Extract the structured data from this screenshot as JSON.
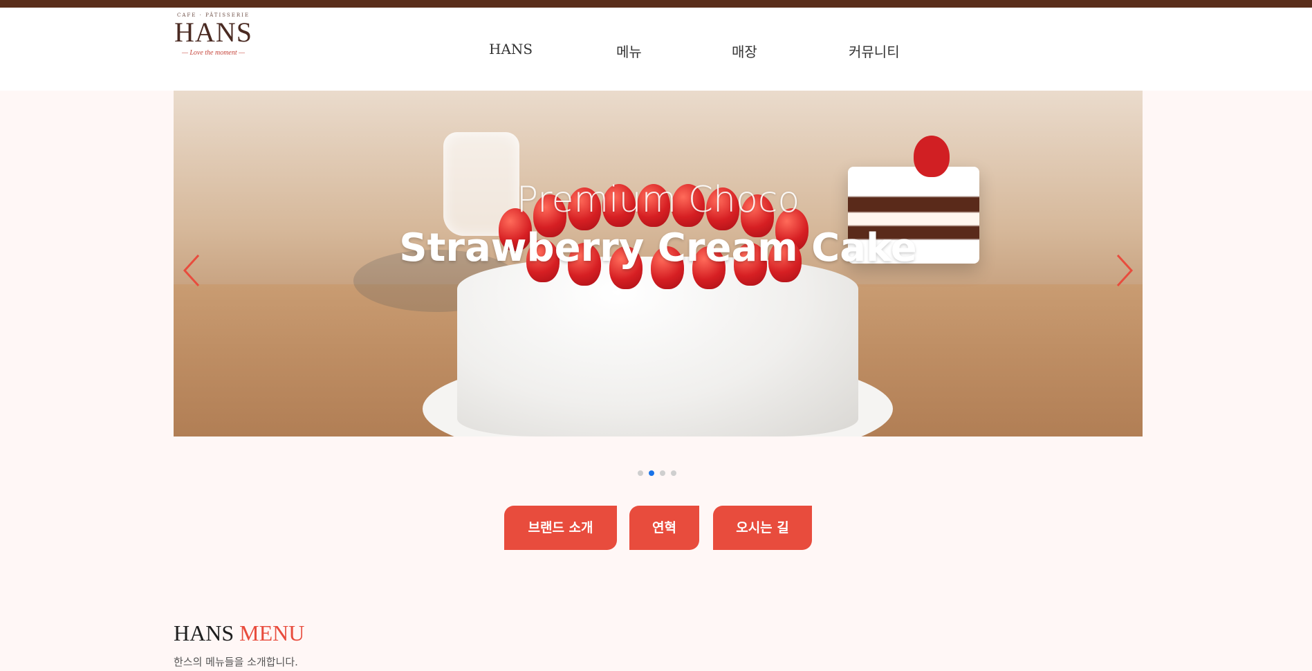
{
  "colors": {
    "topbar": "#5a2e1b",
    "accent": "#e84c3d",
    "background": "#fff7f6",
    "dot_active": "#1a73e8",
    "dot_inactive": "#cfcfcf"
  },
  "logo": {
    "top_text": "CAFE · PÂTISSERIE",
    "name": "HANS",
    "tagline": "— Love the moment —"
  },
  "nav": {
    "items": [
      {
        "label": "HANS"
      },
      {
        "label": "메뉴"
      },
      {
        "label": "매장"
      },
      {
        "label": "커뮤니티"
      }
    ]
  },
  "hero": {
    "title_line1": "Premium Choco",
    "title_line2": "Strawberry Cream Cake",
    "prev_icon": "chevron-left-icon",
    "next_icon": "chevron-right-icon",
    "slide_count": 4,
    "active_slide_index": 1
  },
  "actions": {
    "buttons": [
      {
        "label": "브랜드 소개"
      },
      {
        "label": "연혁"
      },
      {
        "label": "오시는 길"
      }
    ]
  },
  "menu_section": {
    "title_main": "HANS",
    "title_accent": "MENU",
    "subtitle": "한스의 메뉴들을 소개합니다."
  }
}
